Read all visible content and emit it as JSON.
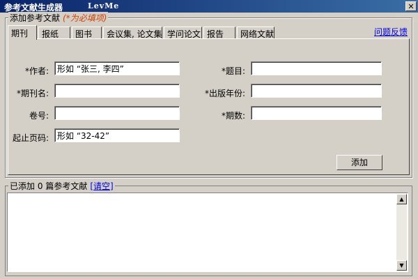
{
  "window": {
    "title": "参考文献生成器",
    "version": "LevMe",
    "close_symbol": "✕"
  },
  "add_group": {
    "legend": "添加参考文献",
    "required_note": "(*为必填项)"
  },
  "tabs": [
    {
      "label": "期刊",
      "active": true
    },
    {
      "label": "报纸"
    },
    {
      "label": "图书"
    },
    {
      "label": "会议集, 论文集"
    },
    {
      "label": "学问论文"
    },
    {
      "label": "报告"
    },
    {
      "label": "网络文献"
    }
  ],
  "feedback_link": "问题反馈",
  "form": {
    "author": {
      "label": "*作者:",
      "value": "形如 “张三, 李四”"
    },
    "title": {
      "label": "*题目:",
      "value": ""
    },
    "journal": {
      "label": "*期刊名:",
      "value": ""
    },
    "year": {
      "label": "*出版年份:",
      "value": ""
    },
    "volume": {
      "label": "卷号:",
      "value": ""
    },
    "issue": {
      "label": "*期数:",
      "value": ""
    },
    "pages": {
      "label": "起止页码:",
      "value": "形如 “32-42”"
    }
  },
  "add_button": "添加",
  "result_group": {
    "prefix": "已添加",
    "count": "0",
    "suffix": "篇参考文献",
    "clear_link": "[请空]"
  }
}
